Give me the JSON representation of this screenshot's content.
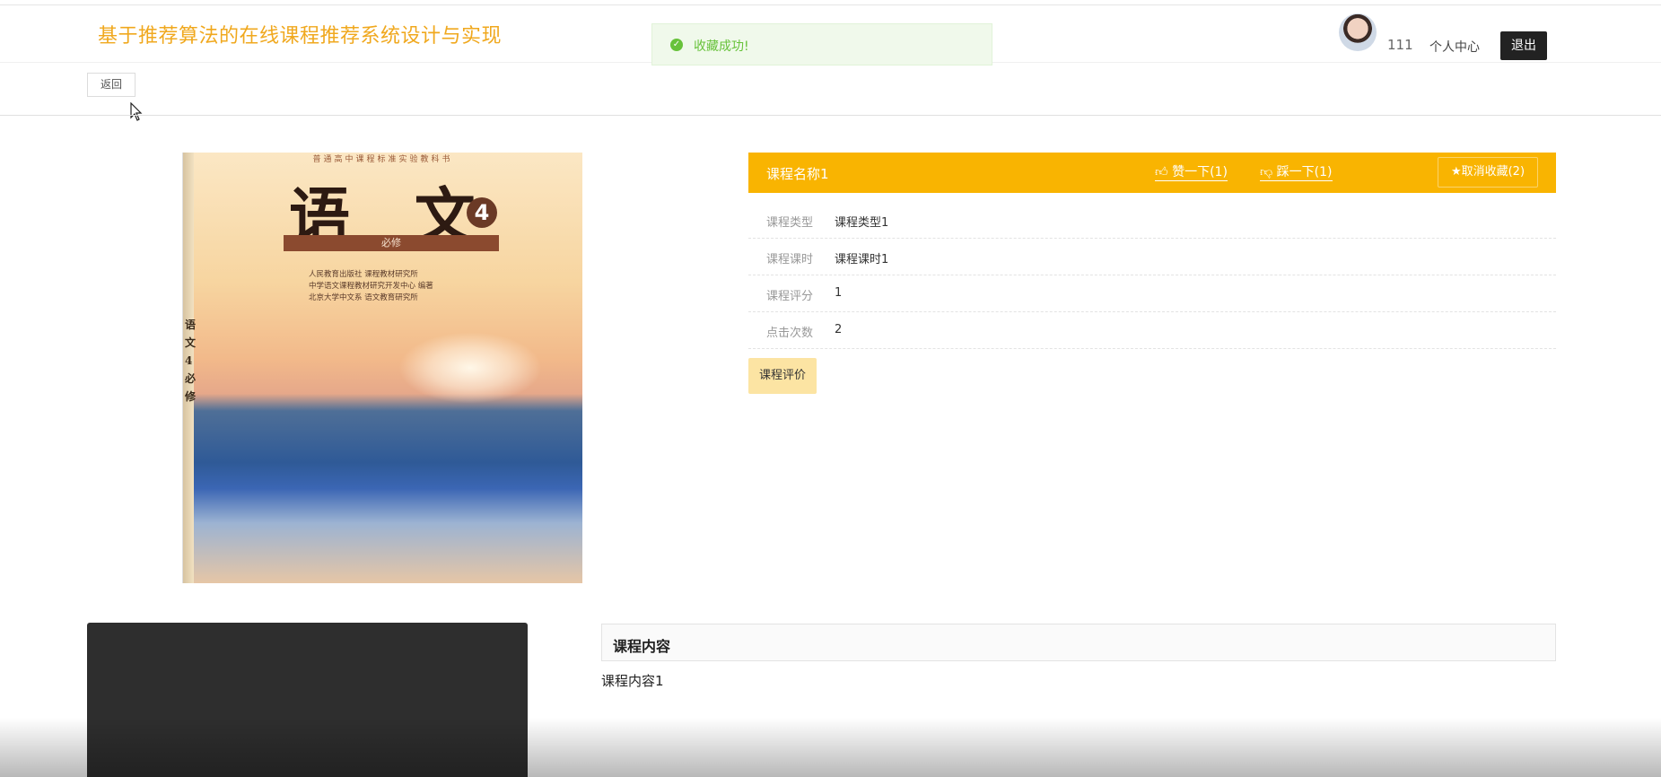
{
  "header": {
    "site_title": "基于推荐算法的在线课程推荐系统设计与实现",
    "username": "111",
    "center_link": "个人中心",
    "logout_label": "退出",
    "accent_color": "#f0a81e"
  },
  "toast": {
    "message": "收藏成功!",
    "icon": "check-circle-icon",
    "color": "#67c23a"
  },
  "nav": {
    "back_label": "返回"
  },
  "cover": {
    "series_text": "普通高中课程标准实验教科书",
    "title": "语 文",
    "volume": "4",
    "band_text": "必修",
    "publisher_lines": [
      "人民教育出版社 课程教材研究所",
      "中学语文课程教材研究开发中心 编著",
      "北京大学中文系 语文教育研究所"
    ],
    "spine_text": "语文4必修"
  },
  "course": {
    "name": "课程名称1",
    "like_label": "赞一下(1)",
    "dislike_label": "踩一下(1)",
    "unfav_label": "取消收藏(2)",
    "header_color": "#f9b401",
    "fields": [
      {
        "label": "课程类型",
        "value": "课程类型1"
      },
      {
        "label": "课程课时",
        "value": "课程课时1"
      },
      {
        "label": "课程评分",
        "value": "1"
      },
      {
        "label": "点击次数",
        "value": "2"
      }
    ],
    "review_label": "课程评价"
  },
  "content": {
    "title": "课程内容",
    "text": "课程内容1"
  }
}
